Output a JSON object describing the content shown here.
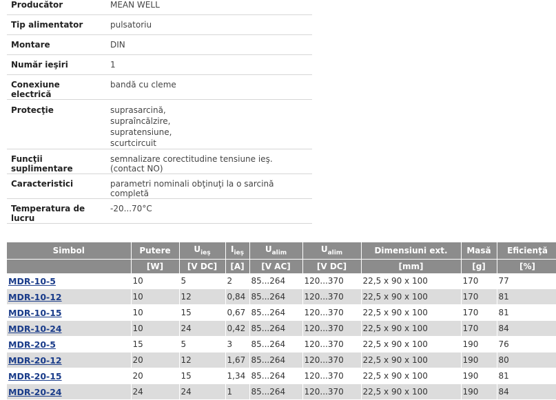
{
  "specs": [
    {
      "key": "Producător",
      "value": "MEAN WELL"
    },
    {
      "key": "Tip alimentator",
      "value": "pulsatoriu"
    },
    {
      "key": "Montare",
      "value": "DIN"
    },
    {
      "key": "Număr ieşiri",
      "value": "1"
    },
    {
      "key": "Conexiune electrică",
      "value": "bandă cu cleme"
    },
    {
      "key": "Protecţie",
      "lines": [
        "suprasarcină,",
        "supraîncălzire,",
        "supratensiune,",
        "scurtcircuit"
      ]
    },
    {
      "key": "Funcţii suplimentare",
      "value": "semnalizare corectitudine tensiune ieş. (contact NO)"
    },
    {
      "key": "Caracteristici",
      "value": "parametri nominali obţinuţi la o sarcină completă"
    },
    {
      "key": "Temperatura de lucru",
      "value": "-20...70°C"
    }
  ],
  "table": {
    "headers": {
      "simbol": "Simbol",
      "putere": "Putere",
      "u_ies": "U",
      "u_ies_sub": "ieş",
      "i_ies": "I",
      "i_ies_sub": "ieş",
      "u_alim_ac": "U",
      "u_alim_ac_sub": "alim",
      "u_alim_dc": "U",
      "u_alim_dc_sub": "alim",
      "dimensiuni": "Dimensiuni ext.",
      "masa": "Masă",
      "eficienta": "Eficienţă"
    },
    "units": [
      "",
      "[W]",
      "[V DC]",
      "[A]",
      "[V AC]",
      "[V DC]",
      "[mm]",
      "[g]",
      "[%]"
    ],
    "rows": [
      [
        "MDR-10-5",
        "10",
        "5",
        "2",
        "85...264",
        "120...370",
        "22,5 x 90 x 100",
        "170",
        "77"
      ],
      [
        "MDR-10-12",
        "10",
        "12",
        "0,84",
        "85...264",
        "120...370",
        "22,5 x 90 x 100",
        "170",
        "81"
      ],
      [
        "MDR-10-15",
        "10",
        "15",
        "0,67",
        "85...264",
        "120...370",
        "22,5 x 90 x 100",
        "170",
        "81"
      ],
      [
        "MDR-10-24",
        "10",
        "24",
        "0,42",
        "85...264",
        "120...370",
        "22,5 x 90 x 100",
        "170",
        "84"
      ],
      [
        "MDR-20-5",
        "15",
        "5",
        "3",
        "85...264",
        "120...370",
        "22,5 x 90 x 100",
        "190",
        "76"
      ],
      [
        "MDR-20-12",
        "20",
        "12",
        "1,67",
        "85...264",
        "120...370",
        "22,5 x 90 x 100",
        "190",
        "80"
      ],
      [
        "MDR-20-15",
        "20",
        "15",
        "1,34",
        "85...264",
        "120...370",
        "22,5 x 90 x 100",
        "190",
        "81"
      ],
      [
        "MDR-20-24",
        "24",
        "24",
        "1",
        "85...264",
        "120...370",
        "22,5 x 90 x 100",
        "190",
        "84"
      ]
    ]
  }
}
